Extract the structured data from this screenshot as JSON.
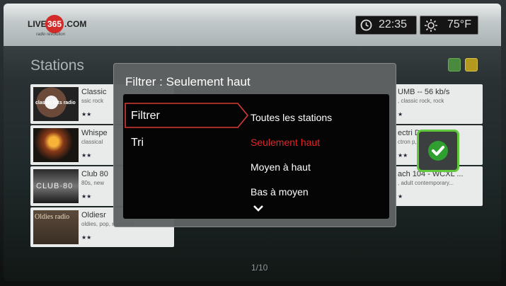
{
  "header": {
    "logo": {
      "live": "LIVE",
      "number": "365",
      "com": ".COM",
      "tagline": "radio revolution"
    },
    "time": "22:35",
    "temperature": "75°F"
  },
  "stations_title": "Stations",
  "stations_left": [
    {
      "title": "Classic",
      "subtitle": "ssic rock",
      "thumb_text": "classic hits radio",
      "stars": "★★"
    },
    {
      "title": "Whispe",
      "subtitle": "classical",
      "thumb_text": "",
      "stars": "★★"
    },
    {
      "title": "Club 80",
      "subtitle": "80s, new",
      "thumb_text": "CLUB·80",
      "stars": "★★"
    },
    {
      "title": "Oldiesr",
      "subtitle": "oldies, pop, rock&roll",
      "thumb_text": "Oldies radio",
      "stars": "★★"
    }
  ],
  "stations_right": [
    {
      "title": "UMB -- 56 kb/s",
      "subtitle": ", classic rock, rock",
      "stars": "★"
    },
    {
      "title": "ectri          D...",
      "subtitle": "ctron           p, r&.",
      "stars": "★★"
    },
    {
      "title": "ach 104 - WCXL ...",
      "subtitle": ", adult contemporary...",
      "stars": "★"
    }
  ],
  "page_indicator": "1/10",
  "dialog": {
    "title": "Filtrer : Seulement haut",
    "categories": [
      "Filtrer",
      "Tri"
    ],
    "options": [
      "Toutes les stations",
      "Seulement haut",
      "Moyen à haut",
      "Bas à moyen"
    ],
    "selected_option": "Seulement haut"
  },
  "colors": {
    "accent_red": "#e02828",
    "check_green": "#60c83a"
  },
  "icons": [
    "clock-icon",
    "sun-icon",
    "checkmark-icon",
    "chevron-down-icon"
  ]
}
